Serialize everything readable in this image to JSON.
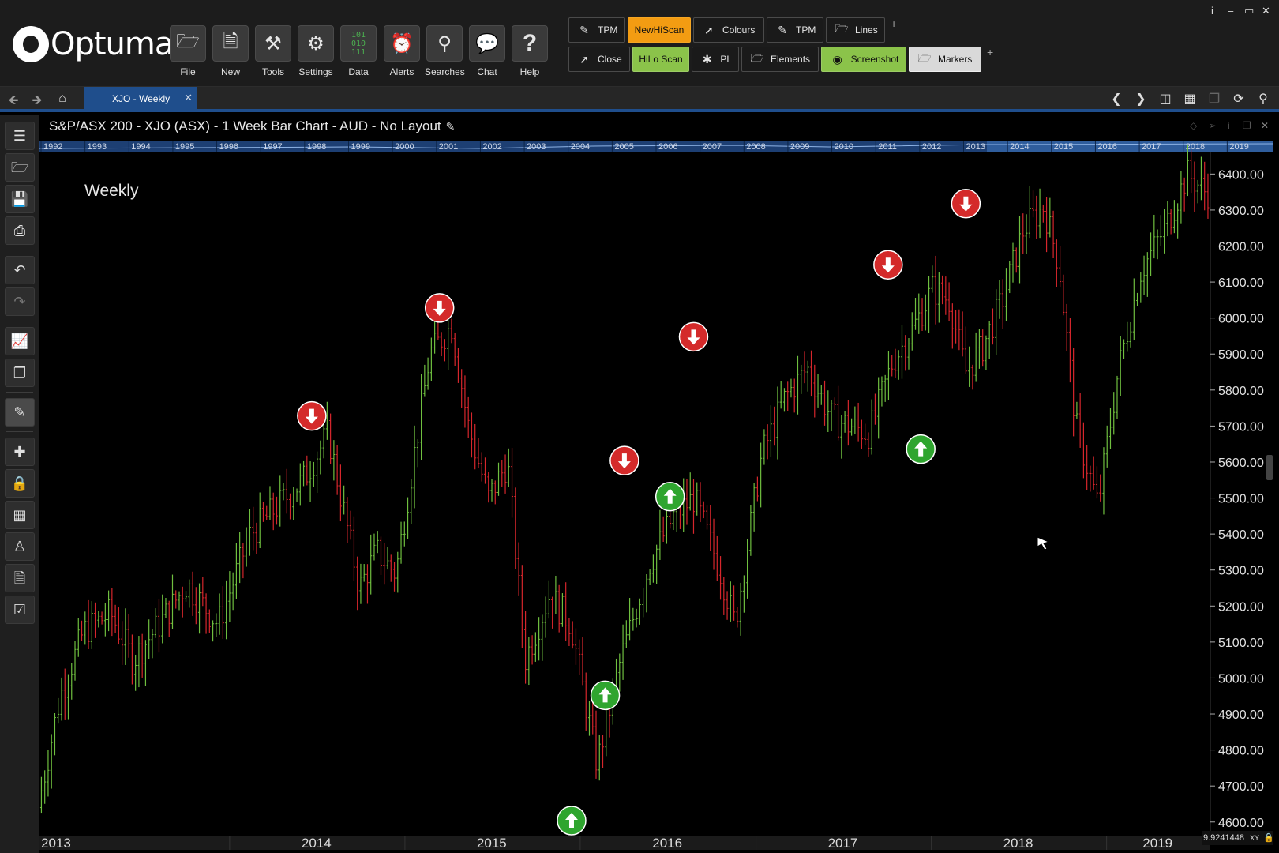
{
  "app": {
    "logo_text": "Optuma",
    "logo_mark": "®"
  },
  "window_controls": [
    "i",
    "–",
    "▭",
    "✕"
  ],
  "ribbon": {
    "big_tools": [
      {
        "name": "file",
        "label": "File",
        "icon": "folder-icon"
      },
      {
        "name": "new",
        "label": "New",
        "icon": "new-chart-icon"
      },
      {
        "name": "tools",
        "label": "Tools",
        "icon": "tools-icon"
      },
      {
        "name": "settings",
        "label": "Settings",
        "icon": "gears-icon"
      },
      {
        "name": "data",
        "label": "Data",
        "icon": "binary-data-icon"
      },
      {
        "name": "alerts",
        "label": "Alerts",
        "icon": "alarm-clock-icon"
      },
      {
        "name": "searches",
        "label": "Searches",
        "icon": "magnifier-icon"
      },
      {
        "name": "chat",
        "label": "Chat",
        "icon": "chat-bubbles-icon"
      },
      {
        "name": "help",
        "label": "Help",
        "icon": "question-mark-icon"
      }
    ],
    "quick_row1": [
      {
        "label": "TPM",
        "icon": "pencil-icon",
        "style": "dark"
      },
      {
        "label": "NewHiScan",
        "icon": "",
        "style": "orange"
      },
      {
        "label": "Colours",
        "icon": "line-icon",
        "style": "dark"
      },
      {
        "label": "TPM",
        "icon": "pencil-icon",
        "style": "dark"
      },
      {
        "label": "Lines",
        "icon": "folder-icon",
        "style": "dark"
      }
    ],
    "quick_row2": [
      {
        "label": "Close",
        "icon": "line-icon",
        "style": "dark"
      },
      {
        "label": "HiLo Scan",
        "icon": "",
        "style": "green"
      },
      {
        "label": "PL",
        "icon": "sparkle-icon",
        "style": "dark"
      },
      {
        "label": "Elements",
        "icon": "folder-icon",
        "style": "dark"
      },
      {
        "label": "Screenshot",
        "icon": "camera-icon",
        "style": "green"
      },
      {
        "label": "Markers",
        "icon": "folder-icon",
        "style": "light"
      }
    ],
    "add_symbol": "+"
  },
  "tabs": [
    {
      "label": "XJO - Weekly",
      "close": "✕"
    }
  ],
  "chart": {
    "title": "S&P/ASX 200 - XJO (ASX) - 1 Week Bar Chart - AUD - No Layout",
    "period_label": "Weekly",
    "coordinate_readout": "9.9241448",
    "coordinate_suffix": "XY"
  },
  "colors": {
    "background": "#000000",
    "up_bar": "#6fbf3f",
    "down_bar": "#d6262c",
    "sell_marker": "#d42a2a",
    "buy_marker": "#2fa52f",
    "tab_active": "#1f4e8c",
    "accent_orange": "#f39c12",
    "accent_green": "#8bc34a"
  },
  "chart_data": {
    "type": "bar",
    "instrument": "S&P/ASX 200 - XJO (ASX)",
    "interval": "1 Week",
    "currency": "AUD",
    "ylim": [
      4560,
      6460
    ],
    "y_ticks": [
      "6400.00",
      "6300.00",
      "6200.00",
      "6100.00",
      "6000.00",
      "5900.00",
      "5800.00",
      "5700.00",
      "5600.00",
      "5500.00",
      "5400.00",
      "5300.00",
      "5200.00",
      "5100.00",
      "5000.00",
      "4900.00",
      "4800.00",
      "4700.00",
      "4600.00"
    ],
    "x_years": [
      "2013",
      "2014",
      "2015",
      "2016",
      "2017",
      "2018",
      "2019"
    ],
    "overview_years": [
      "1992",
      "1993",
      "1994",
      "1995",
      "1996",
      "1997",
      "1998",
      "1999",
      "2000",
      "2001",
      "2002",
      "2003",
      "2004",
      "2005",
      "2006",
      "2007",
      "2008",
      "2009",
      "2010",
      "2011",
      "2012",
      "2013",
      "2014",
      "2015",
      "2016",
      "2017",
      "2018",
      "2019"
    ],
    "xlim": [
      "2012-12-01",
      "2019-08-05"
    ],
    "path": [
      [
        "2012-12-05",
        4640
      ],
      [
        "2013-01-20",
        4950
      ],
      [
        "2013-03-10",
        5130
      ],
      [
        "2013-05-05",
        5180
      ],
      [
        "2013-06-20",
        5050
      ],
      [
        "2013-08-15",
        5150
      ],
      [
        "2013-10-10",
        5260
      ],
      [
        "2013-12-15",
        5150
      ],
      [
        "2014-02-20",
        5400
      ],
      [
        "2014-04-20",
        5480
      ],
      [
        "2014-06-10",
        5550
      ],
      [
        "2014-08-01",
        5680
      ],
      [
        "2014-10-05",
        5250
      ],
      [
        "2014-11-10",
        5350
      ],
      [
        "2014-12-20",
        5290
      ],
      [
        "2015-03-01",
        5900
      ],
      [
        "2015-04-15",
        5980
      ],
      [
        "2015-05-20",
        5700
      ],
      [
        "2015-07-01",
        5500
      ],
      [
        "2015-08-10",
        5600
      ],
      [
        "2015-09-15",
        5050
      ],
      [
        "2015-11-05",
        5230
      ],
      [
        "2015-12-20",
        5150
      ],
      [
        "2016-01-30",
        4850
      ],
      [
        "2016-02-12",
        4760
      ],
      [
        "2016-04-01",
        5050
      ],
      [
        "2016-06-01",
        5320
      ],
      [
        "2016-07-20",
        5450
      ],
      [
        "2016-09-01",
        5500
      ],
      [
        "2016-10-25",
        5300
      ],
      [
        "2016-11-25",
        5150
      ],
      [
        "2017-01-20",
        5620
      ],
      [
        "2017-03-10",
        5780
      ],
      [
        "2017-04-25",
        5860
      ],
      [
        "2017-06-15",
        5720
      ],
      [
        "2017-09-01",
        5680
      ],
      [
        "2017-10-20",
        5880
      ],
      [
        "2017-12-01",
        5970
      ],
      [
        "2018-01-10",
        6080
      ],
      [
        "2018-02-15",
        6050
      ],
      [
        "2018-03-20",
        5850
      ],
      [
        "2018-04-25",
        5920
      ],
      [
        "2018-06-05",
        6050
      ],
      [
        "2018-07-20",
        6250
      ],
      [
        "2018-08-30",
        6310
      ],
      [
        "2018-10-01",
        6150
      ],
      [
        "2018-11-05",
        5700
      ],
      [
        "2018-12-21",
        5480
      ],
      [
        "2019-02-01",
        5850
      ],
      [
        "2019-03-20",
        6130
      ],
      [
        "2019-05-10",
        6250
      ],
      [
        "2019-06-25",
        6400
      ],
      [
        "2019-08-02",
        6350
      ]
    ],
    "signals": [
      {
        "type": "sell",
        "date": "2014-06-21",
        "price": 5728
      },
      {
        "type": "sell",
        "date": "2015-03-14",
        "price": 6028
      },
      {
        "type": "sell",
        "date": "2016-04-02",
        "price": 5604
      },
      {
        "type": "sell",
        "date": "2016-08-24",
        "price": 5948
      },
      {
        "type": "sell",
        "date": "2017-10-03",
        "price": 6148
      },
      {
        "type": "sell",
        "date": "2018-03-14",
        "price": 6318
      },
      {
        "type": "buy",
        "date": "2015-12-14",
        "price": 4604
      },
      {
        "type": "buy",
        "date": "2016-02-22",
        "price": 4952
      },
      {
        "type": "buy",
        "date": "2016-07-06",
        "price": 5504
      },
      {
        "type": "buy",
        "date": "2017-12-10",
        "price": 5636
      }
    ],
    "grid": false
  }
}
